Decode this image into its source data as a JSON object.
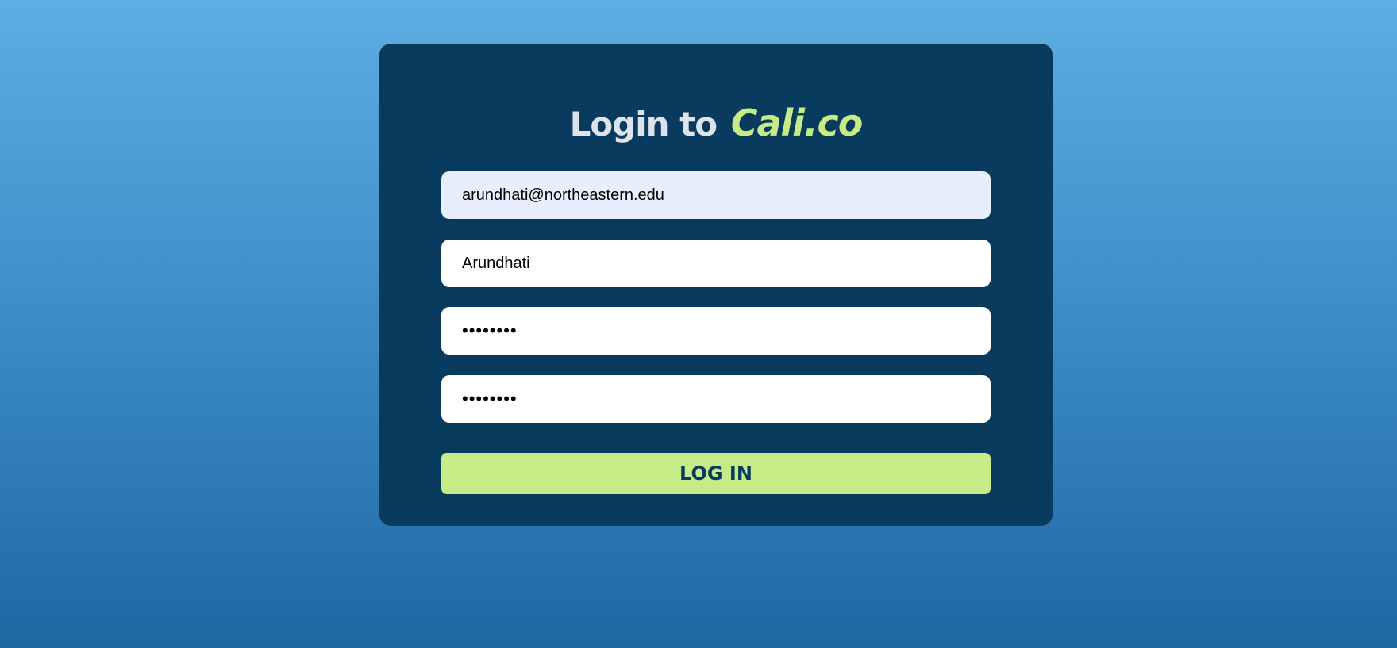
{
  "login": {
    "title_lead": "Login to",
    "brand": "Cali.co",
    "email_value": "arundhati@northeastern.edu",
    "name_value": "Arundhati",
    "password_value": "••••••••",
    "confirm_password_value": "••••••••",
    "submit_label": "LOG IN"
  },
  "colors": {
    "background_top": "#5eaee2",
    "background_bottom": "#1e68a2",
    "card": "#083b5d",
    "accent": "#c5ec87",
    "title_text": "#dce3ea",
    "autofill_field": "#e8effc"
  }
}
